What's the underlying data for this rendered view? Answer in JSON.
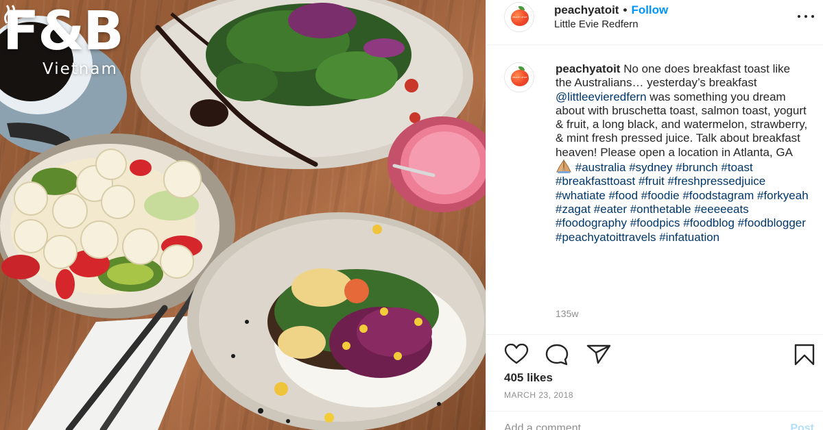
{
  "brand": {
    "mark": "F&B",
    "sub": "Vietnam"
  },
  "post": {
    "username": "peachyatoit",
    "follow_label": "Follow",
    "separator": "•",
    "location": "Little Evie Redfern",
    "avatar_text": "PEACHY ATOIT",
    "caption_text_1": "No one does breakfast toast like the Australians… yesterday’s breakfast",
    "caption_mention": "@littleevieredfern",
    "caption_text_2": "was something you dream about with bruschetta toast, salmon toast, yogurt & fruit, a long black, and watermelon, strawberry, & mint fresh pressed juice. Talk about breakfast heaven! Please open a location in Atlanta, GA",
    "hashtags": [
      "#australia",
      "#sydney",
      "#brunch",
      "#toast",
      "#breakfasttoast",
      "#fruit",
      "#freshpressedjuice",
      "#whatiate",
      "#food",
      "#foodie",
      "#foodstagram",
      "#forkyeah",
      "#zagat",
      "#eater",
      "#onthetable",
      "#eeeeeats",
      "#foodography",
      "#foodpics",
      "#foodblog",
      "#foodblogger",
      "#peachyatoittravels",
      "#infatuation"
    ],
    "time_ago": "135w",
    "likes": "405 likes",
    "date": "MARCH 23, 2018",
    "comment_placeholder": "Add a comment…",
    "post_label": "Post"
  },
  "icons": {
    "more": "more-options-icon",
    "like": "heart-icon",
    "comment": "comment-icon",
    "share": "send-icon",
    "save": "bookmark-icon",
    "emoji": "folded-hands-icon"
  },
  "colors": {
    "link": "#00376b",
    "follow": "#0095f6",
    "muted": "#8e8e8e",
    "text": "#262626"
  }
}
